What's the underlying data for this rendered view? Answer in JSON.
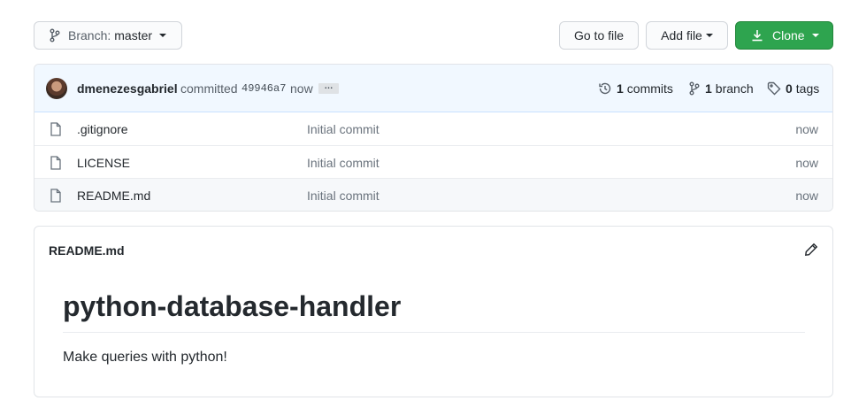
{
  "toolbar": {
    "branch_label": "Branch:",
    "branch_value": "master",
    "goto_file": "Go to file",
    "add_file": "Add file",
    "clone": "Clone",
    "clone_color": "#2ea44f"
  },
  "commit": {
    "author": "dmenezesgabriel",
    "verb": "committed",
    "sha": "49946a7",
    "time": "now",
    "ellipsis": "…"
  },
  "stats": {
    "commits_count": "1",
    "commits_label": "commits",
    "branch_count": "1",
    "branch_label": "branch",
    "tags_count": "0",
    "tags_label": "tags"
  },
  "files": [
    {
      "name": ".gitignore",
      "message": "Initial commit",
      "age": "now"
    },
    {
      "name": "LICENSE",
      "message": "Initial commit",
      "age": "now"
    },
    {
      "name": "README.md",
      "message": "Initial commit",
      "age": "now"
    }
  ],
  "readme": {
    "filename": "README.md",
    "heading": "python-database-handler",
    "paragraph": "Make queries with python!"
  },
  "icons": {
    "branch": "git-branch-icon",
    "download": "download-icon",
    "history": "history-icon",
    "tag": "tag-icon",
    "file": "file-icon",
    "edit": "pencil-icon"
  }
}
